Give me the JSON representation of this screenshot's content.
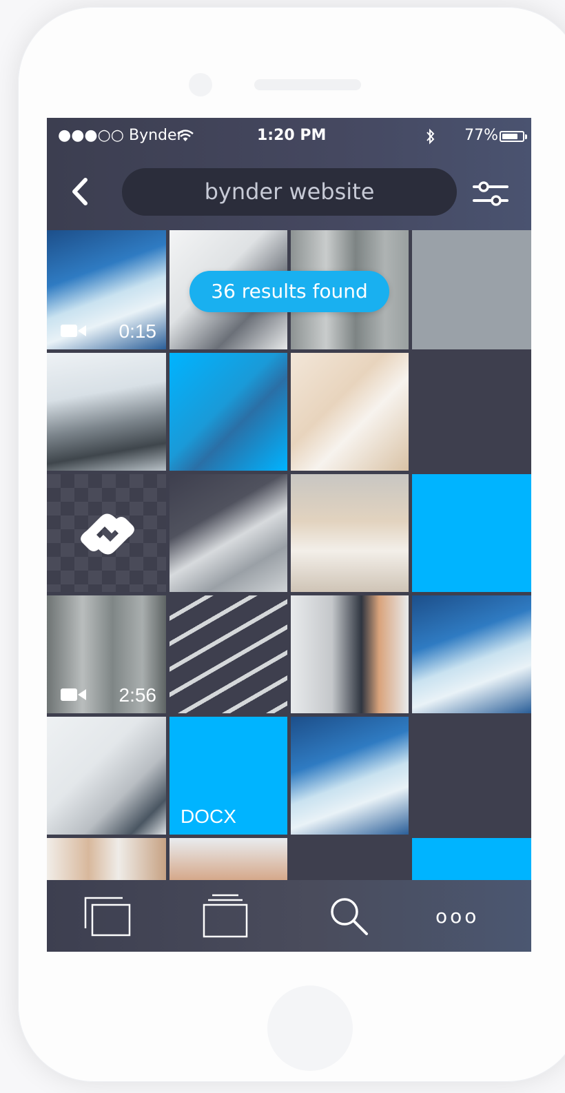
{
  "status_bar": {
    "carrier": "●●●○○ Bynder",
    "time": "1:20 PM",
    "battery": "77%"
  },
  "search": {
    "query": "bynder website"
  },
  "results_toast": "36 results found",
  "tiles": {
    "video_1_duration": "0:15",
    "video_2_duration": "2:56",
    "docx_label": "DOCX"
  },
  "tabbar": {
    "items": [
      "collections-icon",
      "stack-icon",
      "search-icon",
      "more-icon"
    ],
    "more_label": "ooo"
  },
  "colors": {
    "accent": "#00b4ff",
    "dark_tile": "#3e3f4e",
    "grey_tile": "#9aa1a8"
  }
}
